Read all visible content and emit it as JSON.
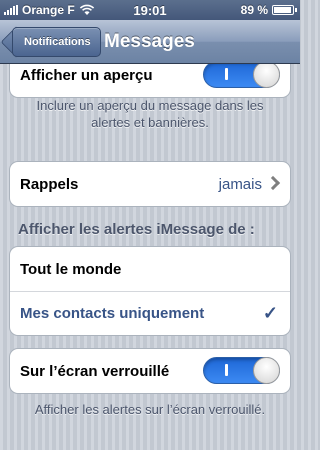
{
  "status_bar": {
    "carrier": "Orange F",
    "time": "19:01",
    "battery_text": "89 %",
    "signal-icon": "signal-bars-icon",
    "wifi-icon": "wifi-icon",
    "battery-icon": "battery-icon"
  },
  "nav": {
    "back_label": "Notifications",
    "title": "Messages"
  },
  "preview_group": {
    "label": "Afficher un aperçu",
    "toggle_on": true,
    "toggle_mark": "I"
  },
  "preview_footer": "Inclure un aperçu du message dans les alertes et bannières.",
  "reminders": {
    "label": "Rappels",
    "value": "jamais"
  },
  "imessage_header": "Afficher les alertes iMessage de :",
  "imessage_options": [
    {
      "label": "Tout le monde",
      "selected": false
    },
    {
      "label": "Mes contacts uniquement",
      "selected": true
    }
  ],
  "lockscreen_group": {
    "label": "Sur l’écran verrouillé",
    "toggle_on": true
  },
  "lockscreen_footer": "Afficher les alertes sur l’écran verrouillé.",
  "colors": {
    "accent": "#385487",
    "toggle_on": "#2f7ce6",
    "nav_bar": "#6c83a4"
  }
}
